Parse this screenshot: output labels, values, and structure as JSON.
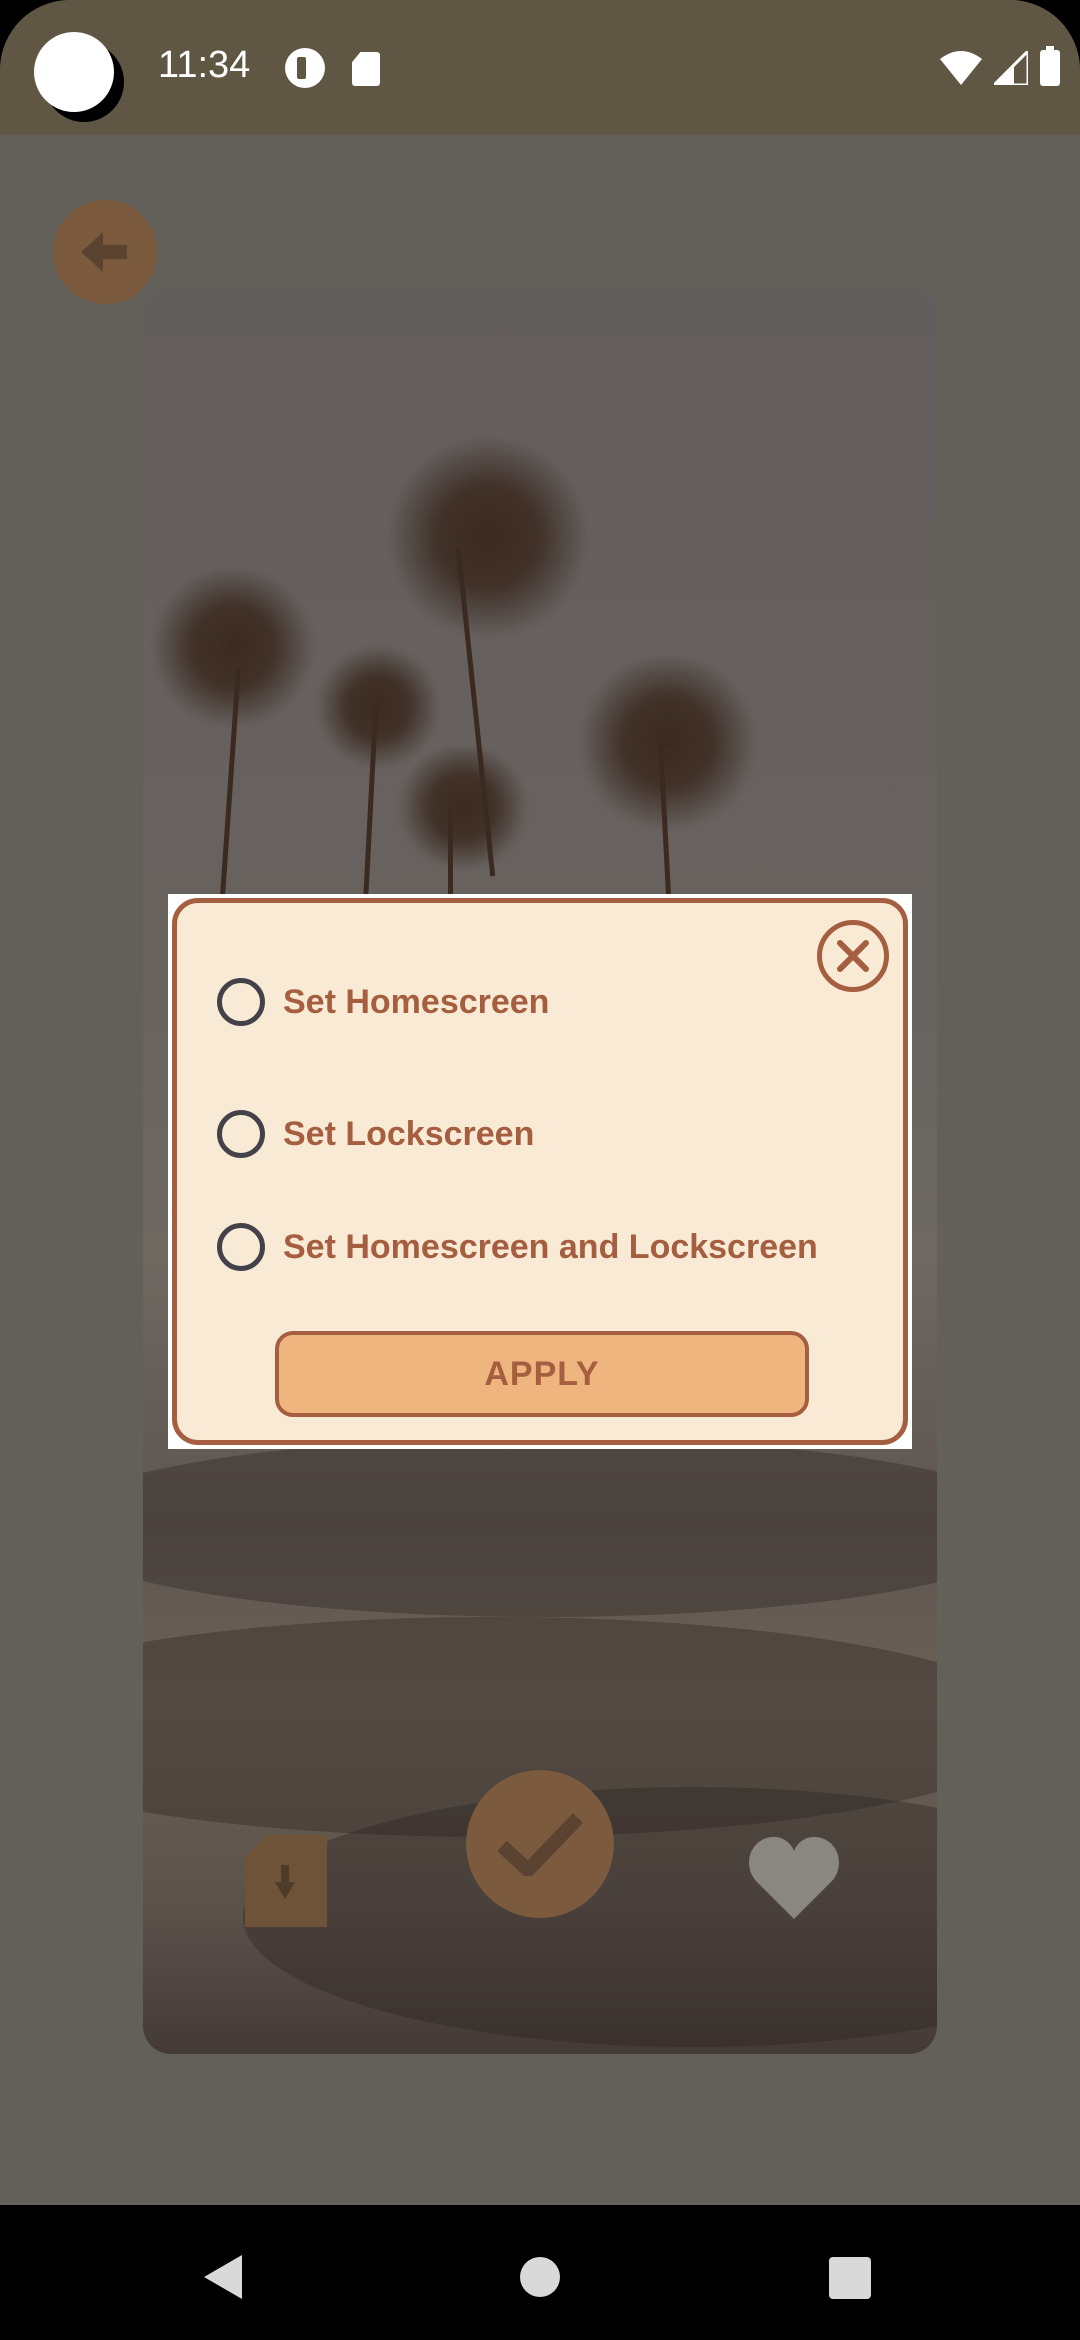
{
  "status_bar": {
    "time": "11:34",
    "icons": [
      "camera-dot",
      "p-icon",
      "sd-card-icon",
      "wifi-icon",
      "signal-icon",
      "battery-icon"
    ]
  },
  "screen": {
    "back_icon": "arrow-left-icon",
    "actions": [
      {
        "name": "save-wallpaper",
        "icon": "file-download-icon"
      },
      {
        "name": "apply-wallpaper",
        "icon": "check-icon"
      },
      {
        "name": "favorite",
        "icon": "heart-icon"
      }
    ]
  },
  "dialog": {
    "close_icon": "close-icon",
    "options": [
      {
        "label": "Set Homescreen",
        "selected": false
      },
      {
        "label": "Set Lockscreen",
        "selected": false
      },
      {
        "label": "Set Homescreen and Lockscreen",
        "selected": false
      }
    ],
    "apply_label": "APPLY"
  },
  "nav_bar": {
    "icons": [
      "back-icon",
      "home-icon",
      "recents-icon"
    ]
  },
  "colors": {
    "accent": "#a55e3f",
    "dialog_bg": "#f8ead5",
    "button_bg": "#efb57f",
    "status_bar_bg": "#5f5644",
    "scrim_bg": "#636059"
  }
}
